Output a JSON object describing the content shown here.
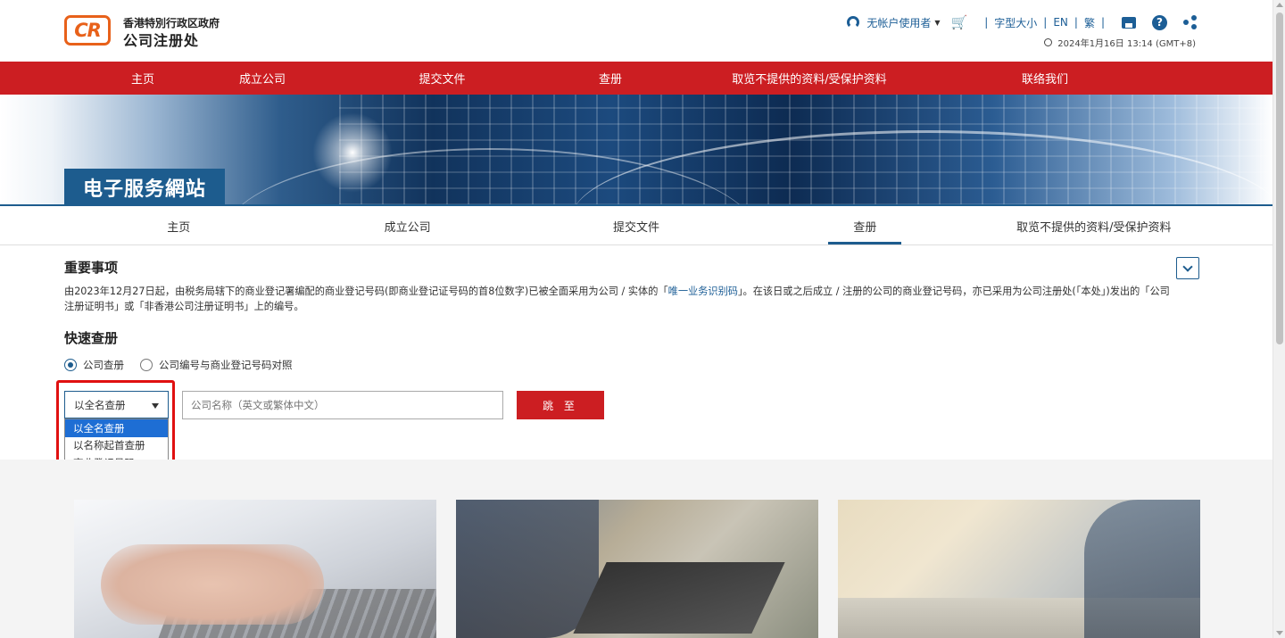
{
  "header": {
    "logo_text": "CR",
    "org_line1": "香港特別行政区政府",
    "org_line2": "公司注册处",
    "user_label": "无帐户使用者",
    "font_size_label": "字型大小",
    "lang_en": "EN",
    "lang_tc": "繁",
    "datetime": "2024年1月16日 13:14 (GMT+8)",
    "icons": [
      "user-icon",
      "cart-icon",
      "print-icon",
      "help-icon",
      "share-icon",
      "clock-icon"
    ]
  },
  "main_nav": [
    {
      "label": "主页"
    },
    {
      "label": "成立公司"
    },
    {
      "label": "提交文件"
    },
    {
      "label": "查册"
    },
    {
      "label": "取览不提供的资料/受保护资料"
    },
    {
      "label": "联络我们"
    }
  ],
  "banner": {
    "title": "电子服务網站"
  },
  "sub_nav": [
    {
      "label": "主页",
      "active": false
    },
    {
      "label": "成立公司",
      "active": false
    },
    {
      "label": "提交文件",
      "active": false
    },
    {
      "label": "查册",
      "active": true
    },
    {
      "label": "取览不提供的资料/受保护资料",
      "active": false
    }
  ],
  "notice": {
    "title": "重要事项",
    "text_part1": "由2023年12月27日起，由税务局辖下的商业登记署编配的商业登记号码(即商业登记证号码的首8位数字)已被全面采用为公司 / 实体的「",
    "link": "唯一业务识别码",
    "text_part2": "」。在该日或之后成立 / 注册的公司的商业登记号码，亦已采用为公司注册处(「本处」)发出的「公司注册证明书」或「非香港公司注册证明书」上的编号。"
  },
  "quick_search": {
    "title": "快速查册",
    "radio_options": [
      {
        "label": "公司查册",
        "checked": true
      },
      {
        "label": "公司编号与商业登记号码对照",
        "checked": false
      }
    ],
    "select_value": "以全名查册",
    "select_options": [
      "以全名查册",
      "以名称起首查册",
      "商业登记号码"
    ],
    "input_placeholder": "公司名称（英文或繁体中文）",
    "go_label": "跳 至"
  },
  "colors": {
    "nav_red": "#cc1e22",
    "brand_blue": "#1d5c8e",
    "logo_orange": "#e8611a",
    "highlight_red": "#e01010",
    "option_selected": "#1e6ed4"
  }
}
